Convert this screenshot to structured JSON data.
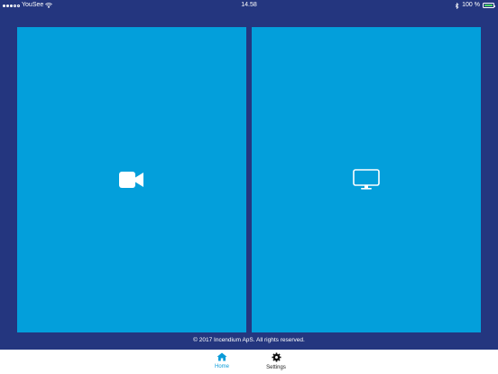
{
  "status_bar": {
    "carrier": "YouSee",
    "time": "14.58",
    "battery_text": "100 %",
    "battery_color": "#4cd964"
  },
  "panels": [
    {
      "icon": "video-camera-icon"
    },
    {
      "icon": "monitor-icon"
    }
  ],
  "footer": {
    "copyright": "© 2017 Incendium ApS. All rights reserved."
  },
  "tab_bar": {
    "tabs": [
      {
        "label": "Home",
        "icon": "home-icon",
        "active": true
      },
      {
        "label": "Settings",
        "icon": "gear-icon",
        "active": false
      }
    ],
    "active_color": "#0a9bd8"
  },
  "colors": {
    "background": "#24367f",
    "panel": "#039fdb"
  }
}
